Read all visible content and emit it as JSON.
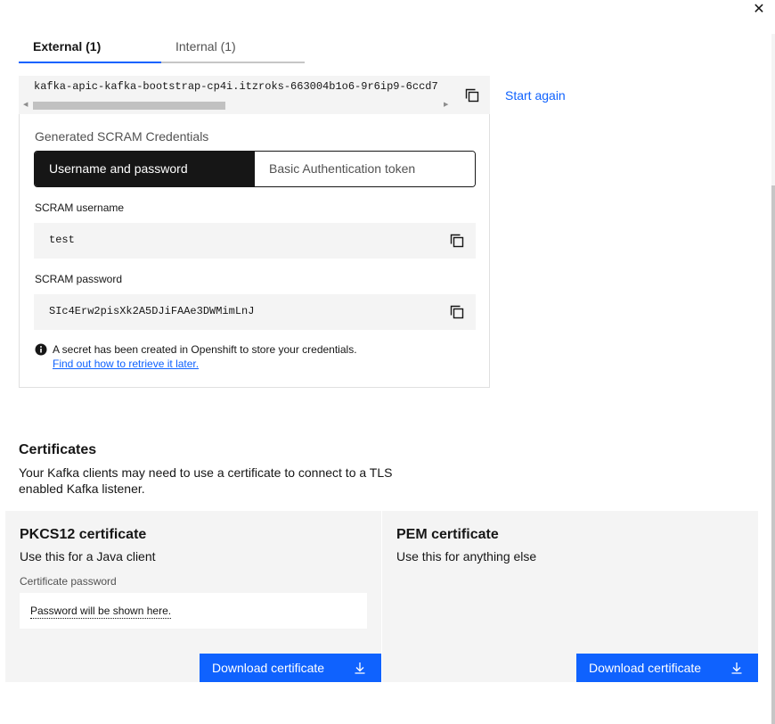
{
  "window": {
    "close_glyph": "✕"
  },
  "tabs": [
    {
      "label": "External (1)",
      "active": true
    },
    {
      "label": "Internal (1)",
      "active": false
    }
  ],
  "endpoint": {
    "value": "kafka-apic-kafka-bootstrap-cp4i.itzroks-663004b1o6-9r6ip9-6ccd7",
    "copy_icon": "copy-icon"
  },
  "start_again_label": "Start again",
  "credentials": {
    "title": "Generated SCRAM Credentials",
    "switcher": [
      {
        "label": "Username and password",
        "active": true
      },
      {
        "label": "Basic Authentication token",
        "active": false
      }
    ],
    "username_label": "SCRAM username",
    "username_value": "test",
    "password_label": "SCRAM password",
    "password_value": "SIc4Erw2pisXk2A5DJiFAAe3DWMimLnJ",
    "notice_text": "A secret has been created in Openshift to store your credentials.",
    "notice_link": "Find out how to retrieve it later."
  },
  "certificates": {
    "heading": "Certificates",
    "description": "Your Kafka clients may need to use a certificate to connect to a TLS enabled Kafka listener.",
    "pkcs12": {
      "title": "PKCS12 certificate",
      "subtitle": "Use this for a Java client",
      "password_label": "Certificate password",
      "password_placeholder": "Password will be shown here.",
      "download_label": "Download certificate"
    },
    "pem": {
      "title": "PEM certificate",
      "subtitle": "Use this for anything else",
      "download_label": "Download certificate"
    }
  },
  "colors": {
    "accent": "#0f62fe",
    "dark": "#161616",
    "surface": "#f4f4f4"
  }
}
